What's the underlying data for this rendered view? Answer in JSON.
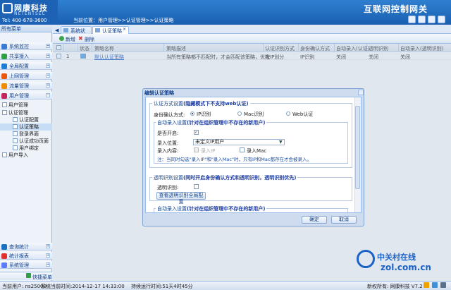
{
  "header": {
    "logo_cn": "网康科技",
    "logo_en": "NETENTSEC",
    "tel": "Tel: 400-678-3600",
    "location": "当前位置：用户管理>>认证管理>>认证策略",
    "product": "互联网控制网关"
  },
  "sidebar": {
    "title": "所有菜单",
    "menus": [
      {
        "label": "系统监控",
        "icon": "monitor-icon",
        "color": "#3a7bd5"
      },
      {
        "label": "共享接入",
        "icon": "share-icon",
        "color": "#2f9e44"
      },
      {
        "label": "全局配置",
        "icon": "globe-icon",
        "color": "#1c7ed6"
      },
      {
        "label": "上网管理",
        "icon": "internet-icon",
        "color": "#e8590c"
      },
      {
        "label": "流量管理",
        "icon": "traffic-icon",
        "color": "#f08c00"
      },
      {
        "label": "用户管理",
        "icon": "users-icon",
        "color": "#c2255c"
      }
    ],
    "tree": [
      {
        "label": "用户管理",
        "indent": 0
      },
      {
        "label": "认证管理",
        "indent": 0
      },
      {
        "label": "认证配置",
        "indent": 1
      },
      {
        "label": "认证策略",
        "indent": 1
      },
      {
        "label": "登录界面",
        "indent": 1
      },
      {
        "label": "认证成功页面",
        "indent": 1
      },
      {
        "label": "用户绑定",
        "indent": 1
      },
      {
        "label": "用户导入",
        "indent": 0
      }
    ],
    "bottom_menus": [
      {
        "label": "查询统计",
        "icon": "query-icon",
        "color": "#1971c2"
      },
      {
        "label": "统计报表",
        "icon": "report-icon",
        "color": "#e03131"
      },
      {
        "label": "系统管理",
        "icon": "system-icon",
        "color": "#5c7cfa"
      }
    ],
    "favorites": "快捷菜单"
  },
  "tabs": [
    {
      "label": "系统状态"
    },
    {
      "label": "认证策略"
    }
  ],
  "toolbar": {
    "new": "新增",
    "delete": "删除"
  },
  "grid": {
    "columns": [
      "状态",
      "策略名称",
      "策略描述",
      "认证识别方式",
      "身份确认方式",
      "自动录入(认证)",
      "透明识别",
      "自动录入(透明识别)"
    ],
    "rows": [
      {
        "no": "1",
        "name": "默认认证策略",
        "desc": "当所有策略都不匹配时，才会匹配该策略，优先",
        "ident": "按IP划分",
        "confirm": "IP识别",
        "auto": "关闭",
        "transparent": "关闭",
        "auto_transparent": "关闭"
      }
    ]
  },
  "dialog": {
    "title": "编辑认证策略",
    "section1": {
      "legend": "认证方式设置",
      "legend_note": "(隐藏模式下不支持web认证)"
    },
    "confirm_label": "身份确认方式:",
    "radios": [
      "IP识别",
      "Mac识别",
      "Web认证"
    ],
    "auto_section": {
      "legend": "自动录入设置",
      "legend_note": "(针对在组织管理中不存在的新用户)"
    },
    "enable_label": "是否开启:",
    "location_label": "录入位置:",
    "location_value": "未定义IP用户",
    "content_label": "录入内容:",
    "content_ip": "录入IP",
    "content_mac": "录入Mac",
    "note": "注：当同时勾选\"录入IP\"和\"录入Mac\"时，只有IP和Mac都存在才会被录入。",
    "transparent_section": {
      "legend": "透明识别设置",
      "legend_note": "(同时开启身份确认方式和透明识别，透明识别优先)"
    },
    "transparent_label": "透明识别:",
    "view_button": "查看透明识别全局配置",
    "auto_section2": {
      "legend": "自动录入设置",
      "legend_note": "(针对在组织管理中不存在的新用户)"
    },
    "ok": "确定",
    "cancel": "取消"
  },
  "status": {
    "user": "当前用户: ns25000",
    "time": "系统当前时间:2014-12-17 14:33:00",
    "uptime": "持续运行时间:51天4时45分",
    "version": "新权所有: 网康科技 V7.2"
  },
  "watermark": {
    "cn": "中关村在线",
    "en": "zol.com.cn"
  }
}
